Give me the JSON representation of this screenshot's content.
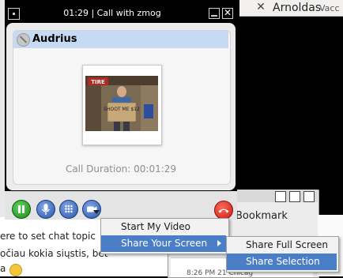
{
  "background": {
    "contact_name": "Arnoldas",
    "contact_sub": "Vacc",
    "chat_topic_hint": "ere to set chat topic",
    "chat_line_1": "očiau kokia siųstis, bet",
    "chat_line_2": "a",
    "browser_bookmark": "Bookmark",
    "feed_text": "8:26 PM 21 Chicag"
  },
  "call_window": {
    "title": "01:29 | Call with zmog",
    "participant_name": "Audrius",
    "call_duration": "Call Duration: 00:01:29",
    "video_sign_text": "SHOOT ME $12",
    "video_banner_text": "TIRE"
  },
  "colors": {
    "highlight": "#4a7fc8",
    "participant_bar": "#c6daf3",
    "hold_green": "#1b8a1b",
    "hangup_red": "#c91c10"
  },
  "toolbar": {
    "icons": [
      "hold-icon",
      "microphone-icon",
      "dialpad-icon",
      "video-camera-icon",
      "hangup-icon"
    ]
  },
  "menu": {
    "start_video": "Start My Video",
    "share_screen": "Share Your Screen",
    "submenu": {
      "share_full": "Share Full Screen",
      "share_selection": "Share Selection"
    }
  }
}
